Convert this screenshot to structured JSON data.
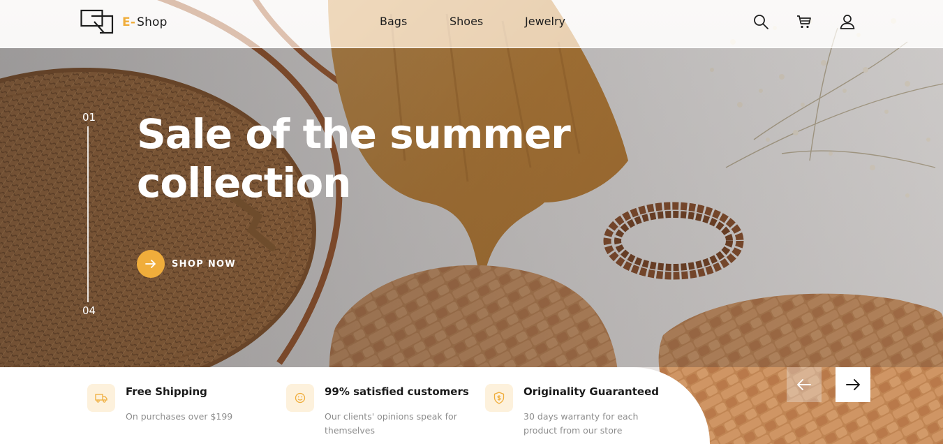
{
  "brand": {
    "accent_glyph": "E-",
    "name": "Shop",
    "accent_color": "#f0ad3b"
  },
  "nav": {
    "items": [
      {
        "label": "Bags"
      },
      {
        "label": "Shoes"
      },
      {
        "label": "Jewelry"
      }
    ],
    "icons": [
      "search-icon",
      "cart-icon",
      "user-icon"
    ]
  },
  "hero": {
    "title": "Sale of the summer collection",
    "cta_label": "SHOP NOW",
    "slide_current": "01",
    "slide_total": "04"
  },
  "features": [
    {
      "icon": "truck-icon",
      "title": "Free Shipping",
      "desc": "On purchases over $199"
    },
    {
      "icon": "smile-icon",
      "title": "99% satisfied customers",
      "desc": "Our clients' opinions speak for themselves"
    },
    {
      "icon": "shield-icon",
      "title": "Originality Guaranteed",
      "desc": "30 days warranty for each product from our store"
    }
  ],
  "slider": {
    "prev_icon": "arrow-left-icon",
    "next_icon": "arrow-right-icon"
  }
}
